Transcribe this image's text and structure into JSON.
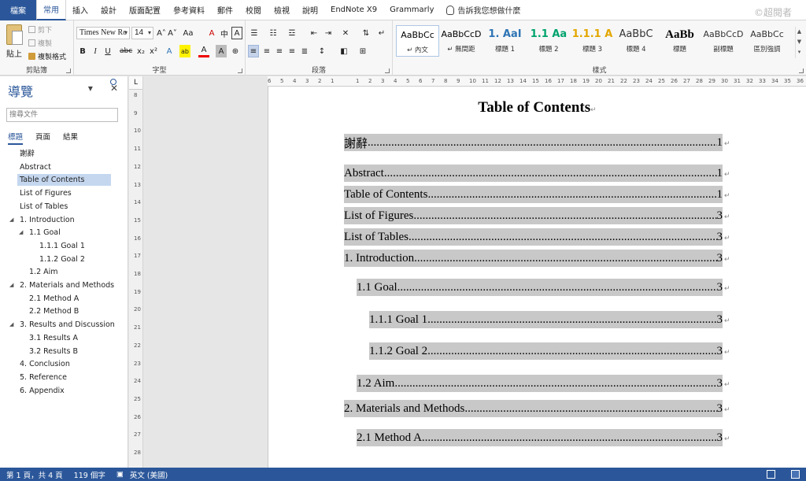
{
  "tabs": [
    "常用",
    "插入",
    "設計",
    "版面配置",
    "參考資料",
    "郵件",
    "校閱",
    "檢視",
    "說明",
    "EndNote X9",
    "Grammarly"
  ],
  "file_tab": "檔案",
  "tell_me": "告訴我您想做什麼",
  "watermark": "©超閱者",
  "clipboard": {
    "paste": "貼上",
    "cut": "剪下",
    "copy": "複製",
    "format_painter": "複製格式",
    "label": "剪貼簿"
  },
  "font": {
    "name": "Times New Ro",
    "size": "14",
    "label": "字型",
    "grow": "A˄",
    "shrink": "A˅",
    "case": "Aa",
    "clear": "A",
    "phonetic": "中",
    "border": "A",
    "bold": "B",
    "italic": "I",
    "underline": "U",
    "strike": "abc",
    "sub": "x₂",
    "sup": "x²",
    "effects": "A",
    "highlight": "ab",
    "color": "A",
    "shade": "A",
    "enclose": "⊕"
  },
  "paragraph": {
    "label": "段落"
  },
  "styles": {
    "label": "樣式",
    "items": [
      {
        "sample": "AaBbCc",
        "name": "↵ 內文",
        "color": "#000000"
      },
      {
        "sample": "AaBbCcD",
        "name": "↵ 無間距",
        "color": "#000000"
      },
      {
        "sample": "1. AaI",
        "name": "標題 1",
        "color": "#2e74b5"
      },
      {
        "sample": "1.1 Aa",
        "name": "標題 2",
        "color": "#00a36c"
      },
      {
        "sample": "1.1.1 A",
        "name": "標題 3",
        "color": "#e3a600"
      },
      {
        "sample": "AaBbC",
        "name": "標題 4",
        "color": "#333333"
      },
      {
        "sample": "AaBb",
        "name": "標題",
        "color": "#000000"
      },
      {
        "sample": "AaBbCcD",
        "name": "副標題",
        "color": "#333333"
      },
      {
        "sample": "AaBbCc",
        "name": "區別強調",
        "color": "#333333"
      }
    ]
  },
  "nav": {
    "title": "導覽",
    "search_placeholder": "搜尋文件",
    "tabs": [
      "標題",
      "頁面",
      "結果"
    ],
    "items": [
      {
        "label": "謝辭",
        "level": 1,
        "expand": false
      },
      {
        "label": "Abstract",
        "level": 1,
        "expand": false
      },
      {
        "label": "Table of Contents",
        "level": 1,
        "expand": false
      },
      {
        "label": "List of Figures",
        "level": 1,
        "expand": false
      },
      {
        "label": "List of Tables",
        "level": 1,
        "expand": false
      },
      {
        "label": "1. Introduction",
        "level": 1,
        "expand": true
      },
      {
        "label": "1.1 Goal",
        "level": 2,
        "expand": true
      },
      {
        "label": "1.1.1 Goal 1",
        "level": 3,
        "expand": false
      },
      {
        "label": "1.1.2 Goal 2",
        "level": 3,
        "expand": false
      },
      {
        "label": "1.2 Aim",
        "level": 2,
        "expand": false
      },
      {
        "label": "2. Materials and Methods",
        "level": 1,
        "expand": true
      },
      {
        "label": "2.1 Method A",
        "level": 2,
        "expand": false
      },
      {
        "label": "2.2 Method B",
        "level": 2,
        "expand": false
      },
      {
        "label": "3. Results and Discussion",
        "level": 1,
        "expand": true
      },
      {
        "label": "3.1 Results A",
        "level": 2,
        "expand": false
      },
      {
        "label": "3.2 Results B",
        "level": 2,
        "expand": false
      },
      {
        "label": "4. Conclusion",
        "level": 1,
        "expand": false
      },
      {
        "label": "5. Reference",
        "level": 1,
        "expand": false
      },
      {
        "label": "6. Appendix",
        "level": 1,
        "expand": false
      }
    ]
  },
  "document": {
    "title": "Table of Contents",
    "entries": [
      {
        "label": "謝辭 ",
        "page": "1",
        "level": 1
      },
      {
        "label": "Abstract",
        "page": "1",
        "level": 1
      },
      {
        "label": "Table of Contents",
        "page": "1",
        "level": 1
      },
      {
        "label": "List of Figures",
        "page": "3",
        "level": 1
      },
      {
        "label": "List of Tables ",
        "page": "3",
        "level": 1
      },
      {
        "label": "1. Introduction",
        "page": "3",
        "level": 1
      },
      {
        "label": "1.1 Goal",
        "page": "3",
        "level": 2
      },
      {
        "label": "1.1.1 Goal 1",
        "page": "3",
        "level": 3
      },
      {
        "label": "1.1.2 Goal 2",
        "page": "3",
        "level": 3
      },
      {
        "label": "1.2 Aim",
        "page": "3",
        "level": 2
      },
      {
        "label": "2. Materials and Methods",
        "page": "3",
        "level": 1
      },
      {
        "label": "2.1 Method A ",
        "page": "3",
        "level": 2
      }
    ]
  },
  "ruler": {
    "h_ticks": [
      "6",
      "5",
      "4",
      "3",
      "2",
      "1",
      "",
      "1",
      "2",
      "3",
      "4",
      "5",
      "6",
      "7",
      "8",
      "9",
      "10",
      "11",
      "12",
      "13",
      "14",
      "15",
      "16",
      "17",
      "18",
      "19",
      "20",
      "21",
      "22",
      "23",
      "24",
      "25",
      "26",
      "27",
      "28",
      "29",
      "30",
      "31",
      "32",
      "33",
      "34",
      "35",
      "36"
    ],
    "v_ticks": [
      "8",
      "9",
      "10",
      "11",
      "12",
      "13",
      "14",
      "15",
      "16",
      "17",
      "18",
      "19",
      "20",
      "21",
      "22",
      "23",
      "24",
      "25",
      "26",
      "27",
      "28",
      "29"
    ]
  },
  "status": {
    "page": "第 1 頁，共 4 頁",
    "words": "119 個字",
    "language": "英文 (美國)"
  }
}
